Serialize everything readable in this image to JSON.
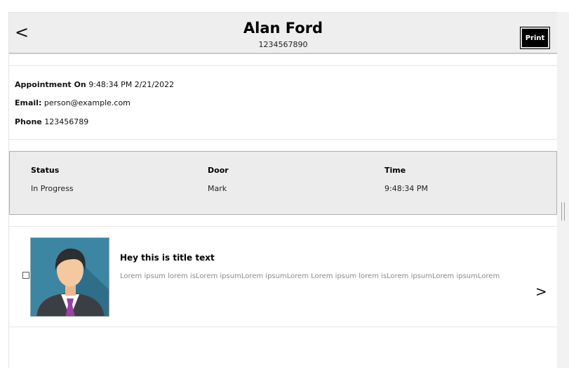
{
  "header": {
    "back_label": "<",
    "title": "Alan Ford",
    "subtitle": "1234567890",
    "print_label": "Print"
  },
  "info": {
    "appointment_label": "Appointment On",
    "appointment_value": "9:48:34 PM 2/21/2022",
    "email_label": "Email:",
    "email_value": "person@example.com",
    "phone_label": "Phone",
    "phone_value": "123456789"
  },
  "status": {
    "columns": [
      {
        "header": "Status",
        "value": "In Progress"
      },
      {
        "header": "Door",
        "value": "Mark"
      },
      {
        "header": "Time",
        "value": "9:48:34 PM"
      }
    ]
  },
  "list": {
    "items": [
      {
        "title": "Hey this is title text",
        "description": "Lorem ipsum lorem isLorem ipsumLorem ipsumLorem Lorem ipsum lorem isLorem ipsumLorem ipsumLorem",
        "chevron": ">",
        "avatar_icon": "person-avatar-icon"
      }
    ]
  },
  "colors": {
    "header_bg": "#eeeeee",
    "status_bg": "#ececec",
    "print_bg": "#000000",
    "avatar_bg": "#3d86a3"
  }
}
